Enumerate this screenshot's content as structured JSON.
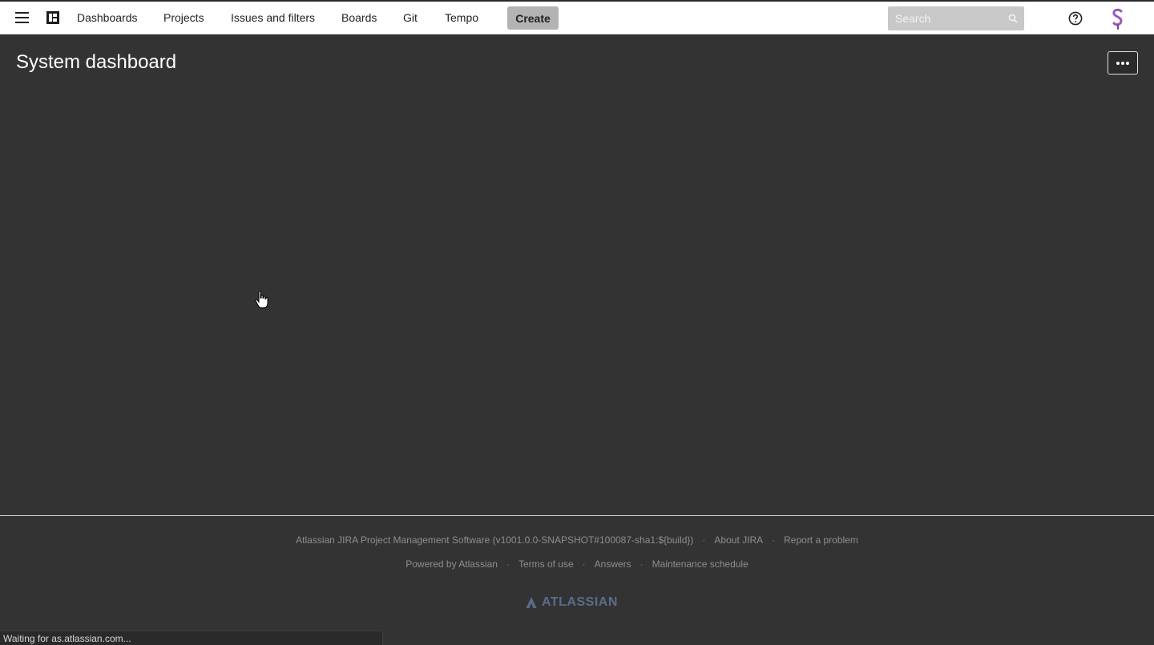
{
  "topnav": {
    "items": [
      {
        "label": "Dashboards"
      },
      {
        "label": "Projects"
      },
      {
        "label": "Issues and filters"
      },
      {
        "label": "Boards"
      },
      {
        "label": "Git"
      },
      {
        "label": "Tempo"
      }
    ],
    "create_label": "Create",
    "search": {
      "placeholder": "Search",
      "value": ""
    }
  },
  "main": {
    "title": "System dashboard"
  },
  "footer": {
    "row1": [
      "Atlassian JIRA Project Management Software (v1001.0.0-SNAPSHOT#100087-sha1:${build})",
      "About JIRA",
      "Report a problem"
    ],
    "row2": [
      "Powered by Atlassian",
      "Terms of use",
      "Answers",
      "Maintenance schedule"
    ],
    "logo_text": "ATLASSIAN"
  },
  "status_bar": {
    "text": "Waiting for as.atlassian.com..."
  },
  "icons": {
    "menu": "hamburger-menu-icon",
    "app": "app-logo-icon",
    "search": "search-icon",
    "help": "help-icon",
    "avatar": "user-avatar",
    "more": "more-actions-icon",
    "atlassian": "atlassian-logo-icon",
    "cursor": "hand-pointer-cursor"
  },
  "colors": {
    "background": "#333333",
    "topnav": "#ffffff",
    "create_button": "#b3b3b3",
    "avatar_accent": "#9b59b6",
    "atlassian_logo": "#5b6d8c"
  }
}
